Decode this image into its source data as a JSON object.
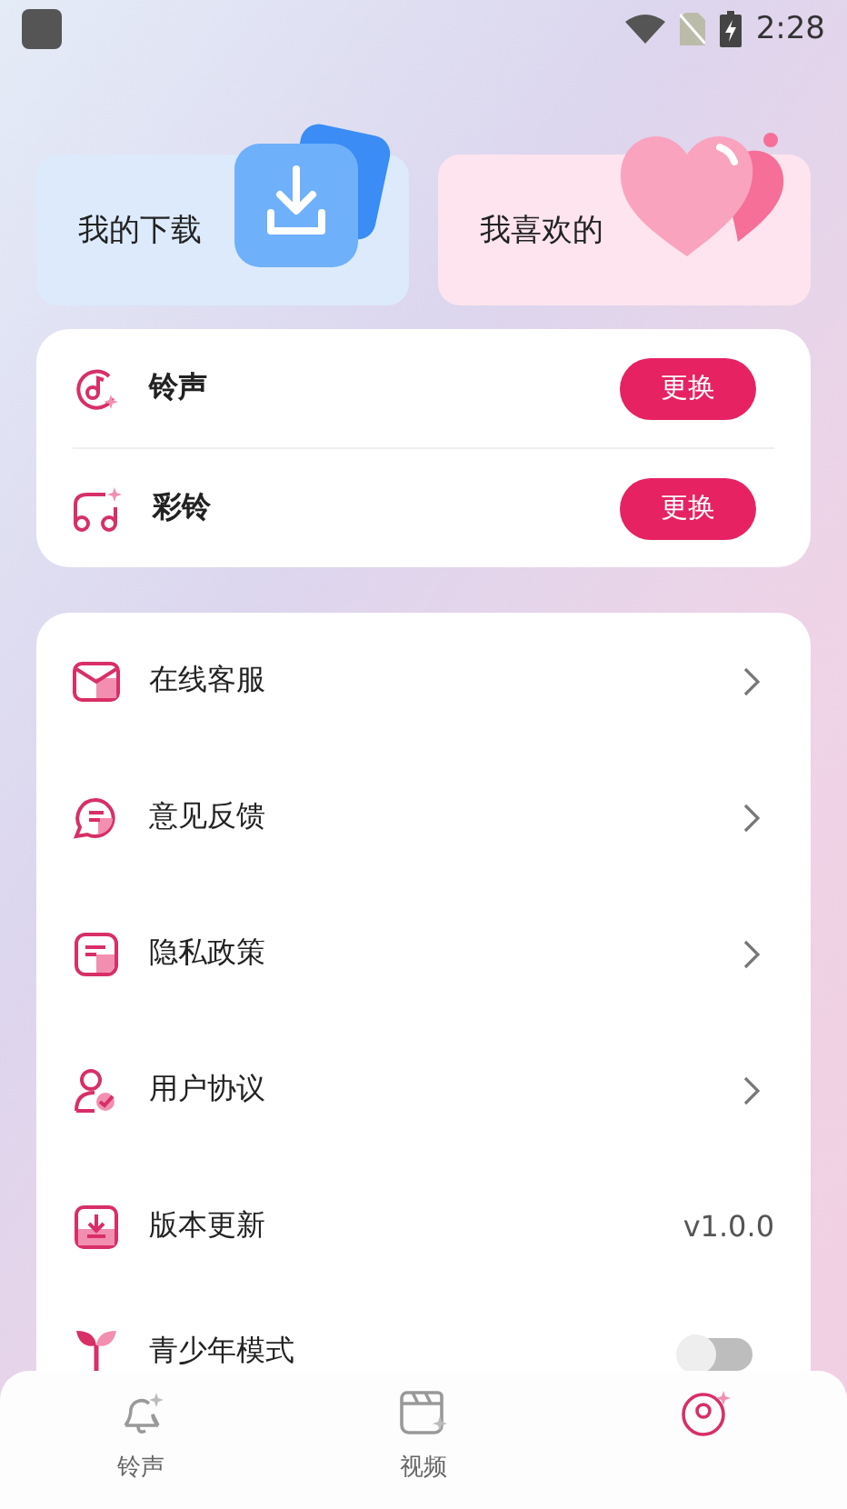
{
  "status_bar": {
    "time": "2:28"
  },
  "quick_cards": [
    {
      "kind": "download",
      "label": "我的下载"
    },
    {
      "kind": "favorite",
      "label": "我喜欢的"
    }
  ],
  "ring_settings": [
    {
      "kind": "ringtone",
      "label": "铃声",
      "button": "更换"
    },
    {
      "kind": "color_ring",
      "label": "彩铃",
      "button": "更换"
    }
  ],
  "menu": [
    {
      "kind": "service",
      "label": "在线客服",
      "arrow": true
    },
    {
      "kind": "feedback",
      "label": "意见反馈",
      "arrow": true
    },
    {
      "kind": "privacy",
      "label": "隐私政策",
      "arrow": true
    },
    {
      "kind": "agreement",
      "label": "用户协议",
      "arrow": true
    },
    {
      "kind": "update",
      "label": "版本更新",
      "value": "v1.0.0"
    },
    {
      "kind": "teen",
      "label": "青少年模式",
      "on": false
    }
  ],
  "tab_bar": [
    {
      "kind": "ringtone",
      "label": "铃声",
      "selected": false
    },
    {
      "kind": "video",
      "label": "视频",
      "selected": false
    },
    {
      "kind": "mine",
      "selected": true
    }
  ]
}
